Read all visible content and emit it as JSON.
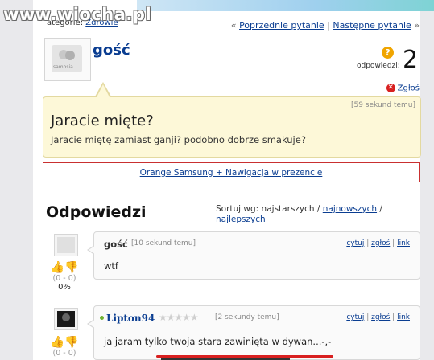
{
  "watermark": "www.wiocha.pl",
  "header": {
    "category_prefix": "ategorie:",
    "category_value": "Zdrowie",
    "prev_link": "Poprzednie pytanie",
    "separator": "|",
    "next_link": "Następne pytanie",
    "prev_arrows": "«",
    "next_arrows": "»"
  },
  "question": {
    "author": "gość",
    "avatar_caption": "samosia",
    "answers_label": "odpowiedzi:",
    "answers_count": "2",
    "answers_icon": "?",
    "report_label": "Zgłoś",
    "time": "[59 sekund temu]",
    "title": "Jaracie mięte?",
    "body": "Jaracie miętę zamiast ganji? podobno dobrze smakuje?"
  },
  "ad": {
    "text": "Orange Samsung + Nawigacja w prezencie"
  },
  "answers_section": {
    "heading": "Odpowiedzi",
    "sort_label": "Sortuj wg: najstarszych /",
    "sort_newest": "najnowszych",
    "sort_sep": "/",
    "sort_best": "najlepszych"
  },
  "answers": [
    {
      "author": "gość",
      "time": "[10 sekund temu]",
      "quote": "cytuj",
      "report": "zgłoś",
      "link": "link",
      "text": "wtf",
      "score": "(0 - 0)",
      "percent": "0%"
    },
    {
      "author": "Lipton94",
      "stars": "★★★★★",
      "time": "[2 sekundy temu]",
      "quote": "cytuj",
      "report": "zgłoś",
      "link": "link",
      "text": "ja jaram tylko twoja stara zawinięta w dywan...-,-",
      "score": "(0 - 0)"
    }
  ],
  "colors": {
    "link": "#0a3d91",
    "question_bg": "#fdf8d8",
    "ad_border": "#c93030",
    "online": "#6fb233"
  }
}
